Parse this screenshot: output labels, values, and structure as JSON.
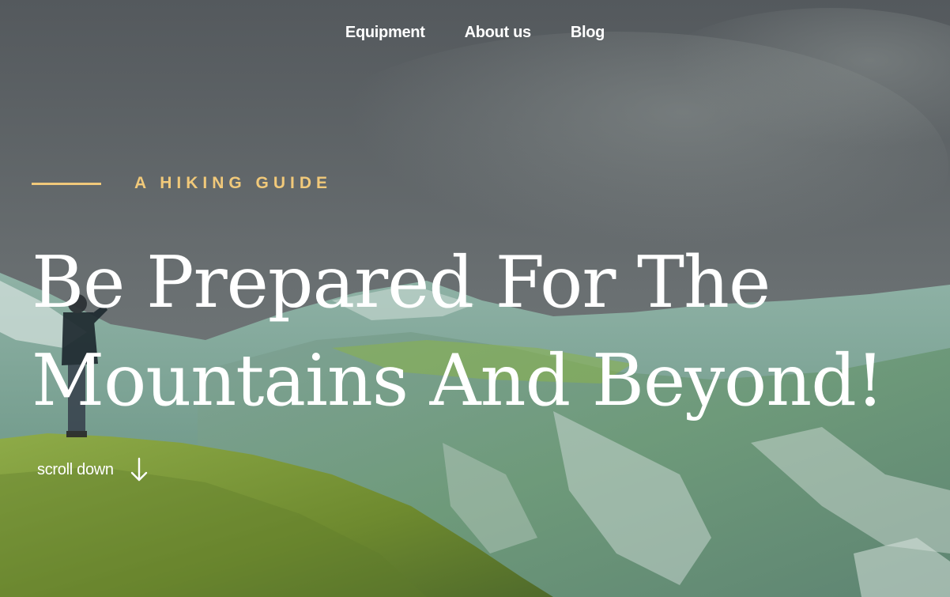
{
  "nav": {
    "items": [
      {
        "label": "Equipment"
      },
      {
        "label": "About us"
      },
      {
        "label": "Blog"
      }
    ]
  },
  "hero": {
    "eyebrow": "A HIKING GUIDE",
    "headline_line1": "Be Prepared For The",
    "headline_line2": "Mountains And Beyond!",
    "scroll_label": "scroll down"
  },
  "colors": {
    "accent": "#f1c97a",
    "text": "#ffffff",
    "sky": "#5b6166",
    "grass": "#7d9a3a",
    "mountain": "#6f9585"
  },
  "icons": {
    "scroll": "arrow-down-icon"
  }
}
